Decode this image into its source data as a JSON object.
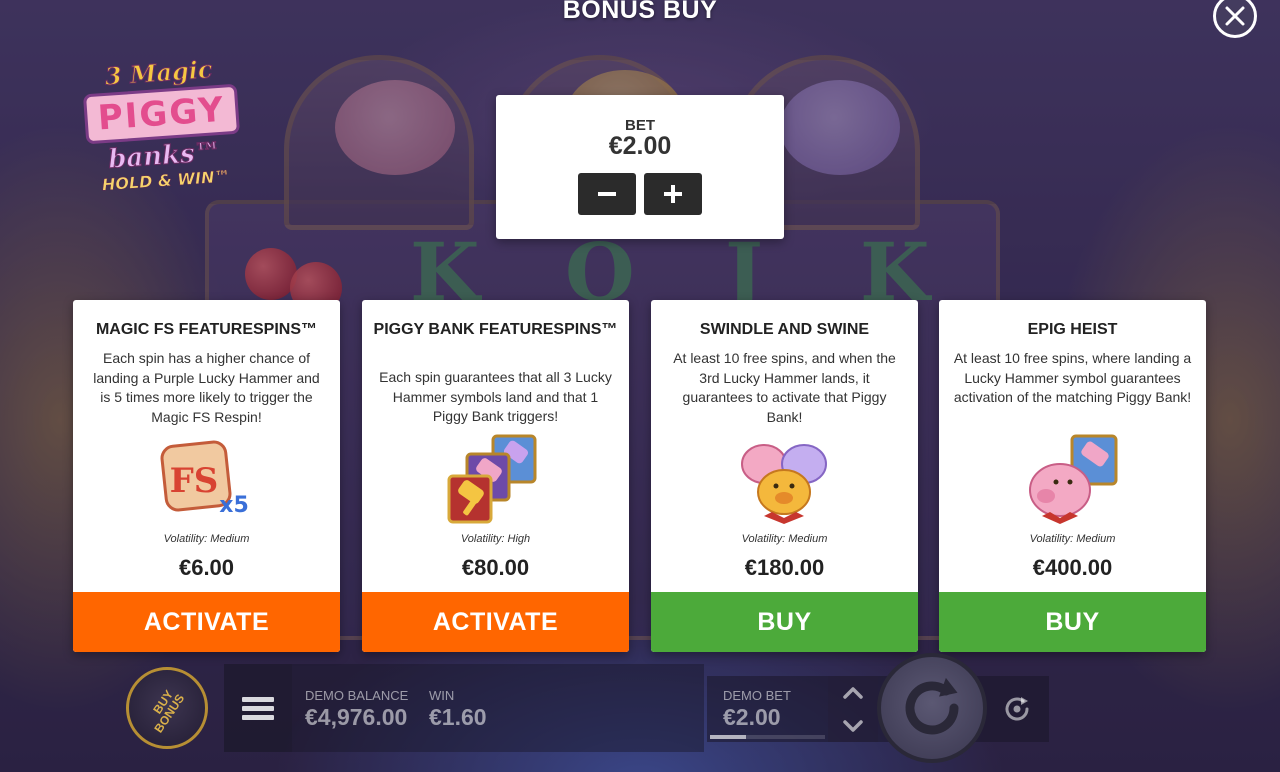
{
  "header": {
    "title": "BONUS BUY"
  },
  "logo": {
    "line1": "3 Magic",
    "line2": "PIGGY",
    "line3": "banks™",
    "line4": "HOLD & WIN™"
  },
  "bet_panel": {
    "label": "BET",
    "value": "€2.00"
  },
  "cards": [
    {
      "title": "MAGIC FS FEATURESPINS™",
      "description": "Each spin has a higher chance of landing a Purple Lucky Hammer and is 5 times more likely to trigger the Magic FS Respin!",
      "volatility": "Volatility: Medium",
      "price": "€6.00",
      "button": "ACTIVATE",
      "icon_text": "FS",
      "icon_multiplier": "x5"
    },
    {
      "title": "PIGGY BANK FEATURESPINS™",
      "description": "Each spin guarantees that all 3 Lucky Hammer symbols land and that 1 Piggy Bank triggers!",
      "volatility": "Volatility: High",
      "price": "€80.00",
      "button": "ACTIVATE"
    },
    {
      "title": "SWINDLE AND SWINE",
      "description": "At least 10 free spins, and when the 3rd Lucky Hammer lands, it guarantees to activate that Piggy Bank!",
      "volatility": "Volatility: Medium",
      "price": "€180.00",
      "button": "BUY"
    },
    {
      "title": "EPIG HEIST",
      "description": "At least 10 free spins, where landing a Lucky Hammer symbol guarantees activation of the matching Piggy Bank!",
      "volatility": "Volatility: Medium",
      "price": "€400.00",
      "button": "BUY"
    }
  ],
  "bottom_bar": {
    "buy_bonus_line1": "BUY",
    "buy_bonus_line2": "BONUS",
    "balance_label": "DEMO BALANCE",
    "balance_value": "€4,976.00",
    "win_label": "WIN",
    "win_value": "€1.60",
    "bet_label": "DEMO BET",
    "bet_value": "€2.00",
    "bet_level_fraction": 0.31
  },
  "colors": {
    "activate": "#ff6600",
    "buy": "#4caa3a",
    "panel": "#ffffff",
    "title_text": "#ffffff"
  },
  "icons": {
    "close": "close-icon",
    "minus": "minus-icon",
    "plus": "plus-icon",
    "menu": "hamburger-menu-icon",
    "spin": "spin-icon",
    "autoplay": "autoplay-icon",
    "bet_up": "chevron-up-icon",
    "bet_down": "chevron-down-icon"
  }
}
